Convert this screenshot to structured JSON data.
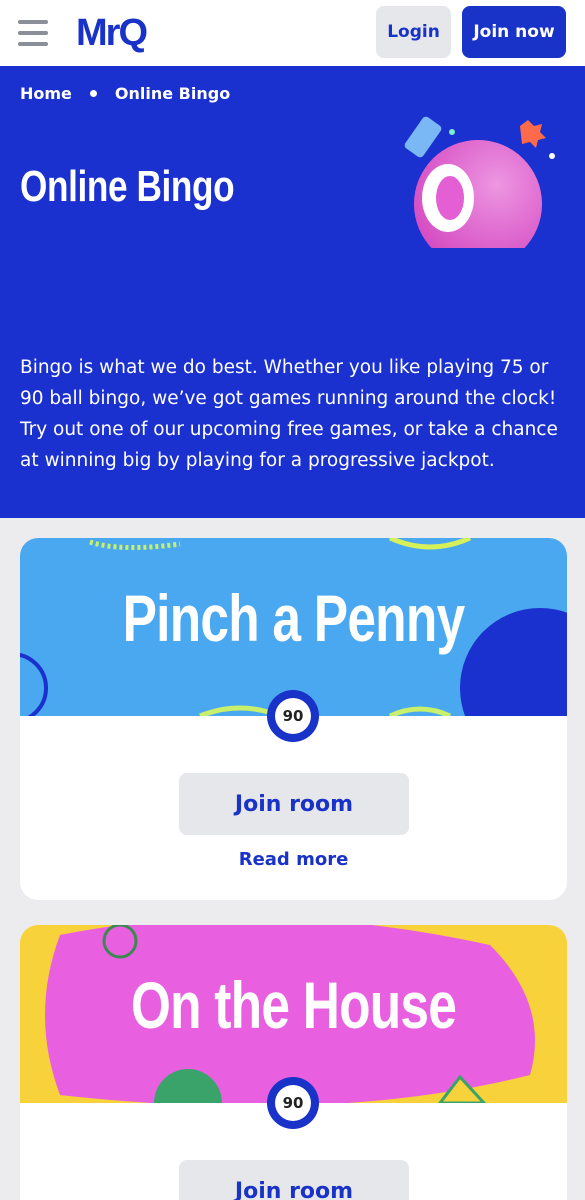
{
  "header": {
    "logo_text": "MrQ",
    "login_label": "Login",
    "join_label": "Join now"
  },
  "breadcrumb": [
    "Home",
    "Online Bingo"
  ],
  "hero": {
    "title": "Online Bingo",
    "description": "Bingo is what we do best. Whether you like playing 75 or 90 ball bingo, we’ve got games running around the clock! Try out one of our upcoming free games, or take a chance at winning big by playing for a progressive jackpot."
  },
  "games": [
    {
      "title": "Pinch a Penny",
      "ball": "90",
      "join_label": "Join room",
      "read_more_label": "Read more"
    },
    {
      "title": "On the House",
      "ball": "90",
      "join_label": "Join room"
    }
  ],
  "colors": {
    "brand_blue": "#1a30cf",
    "button_grey": "#e6e7ea",
    "card1_bg": "#4aa8f0",
    "card2_bg": "#e860e0",
    "card2_accent": "#f7d23a"
  }
}
